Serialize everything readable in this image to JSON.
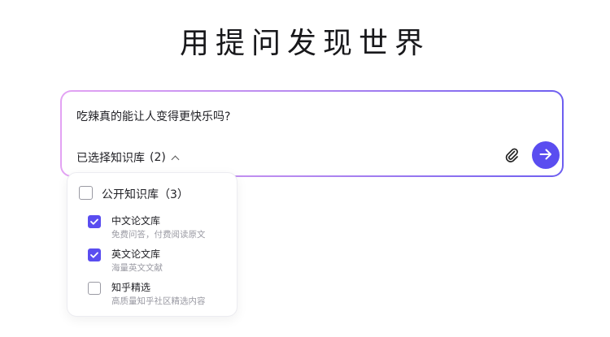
{
  "hero": {
    "title": "用提问发现世界"
  },
  "search": {
    "query": "吃辣真的能让人变得更快乐吗?",
    "kb_label": "已选择知识库",
    "kb_count": "(2)"
  },
  "dropdown": {
    "group": {
      "label": "公开知识库（3）",
      "checked": false
    },
    "items": [
      {
        "name": "中文论文库",
        "desc": "免费问答，付费阅读原文",
        "checked": true
      },
      {
        "name": "英文论文库",
        "desc": "海量英文文献",
        "checked": true
      },
      {
        "name": "知乎精选",
        "desc": "高质量知乎社区精选内容",
        "checked": false
      }
    ]
  },
  "colors": {
    "accent": "#5a4df0",
    "border_gradient_start": "#e3a3f3",
    "border_gradient_end": "#6d5ef0"
  },
  "icons": {
    "attach": "paperclip-icon",
    "send": "arrow-right-icon",
    "toggle": "chevron-up-icon"
  }
}
